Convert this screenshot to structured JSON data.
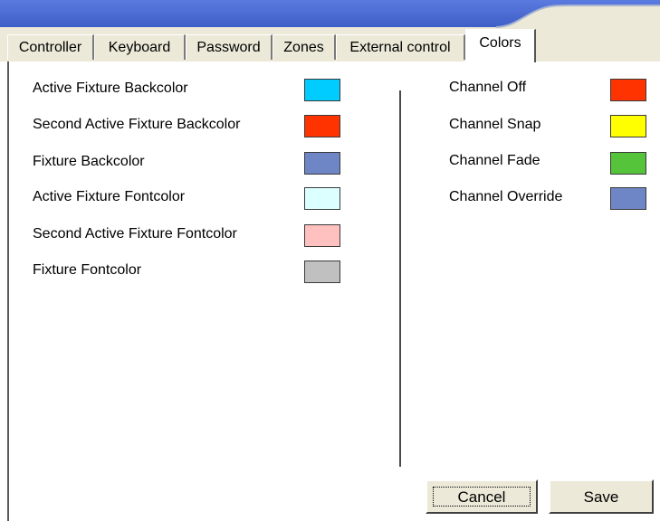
{
  "tabs": [
    {
      "label": "Controller"
    },
    {
      "label": "Keyboard"
    },
    {
      "label": "Password"
    },
    {
      "label": "Zones"
    },
    {
      "label": "External control"
    },
    {
      "label": "Colors",
      "active": true
    }
  ],
  "left_colors": [
    {
      "label": "Active Fixture Backcolor",
      "color": "#00ccff"
    },
    {
      "label": "Second Active Fixture Backcolor",
      "color": "#ff3300"
    },
    {
      "label": "Fixture Backcolor",
      "color": "#6f86c6"
    },
    {
      "label": "Active Fixture Fontcolor",
      "color": "#dcffff"
    },
    {
      "label": "Second Active Fixture Fontcolor",
      "color": "#ffc0c0"
    },
    {
      "label": "Fixture Fontcolor",
      "color": "#c0c0c0"
    }
  ],
  "right_colors": [
    {
      "label": "Channel Off",
      "color": "#ff3300"
    },
    {
      "label": "Channel Snap",
      "color": "#ffff00"
    },
    {
      "label": "Channel Fade",
      "color": "#55c43a"
    },
    {
      "label": "Channel Override",
      "color": "#6f86c6"
    }
  ],
  "buttons": {
    "cancel": "Cancel",
    "save": "Save"
  }
}
